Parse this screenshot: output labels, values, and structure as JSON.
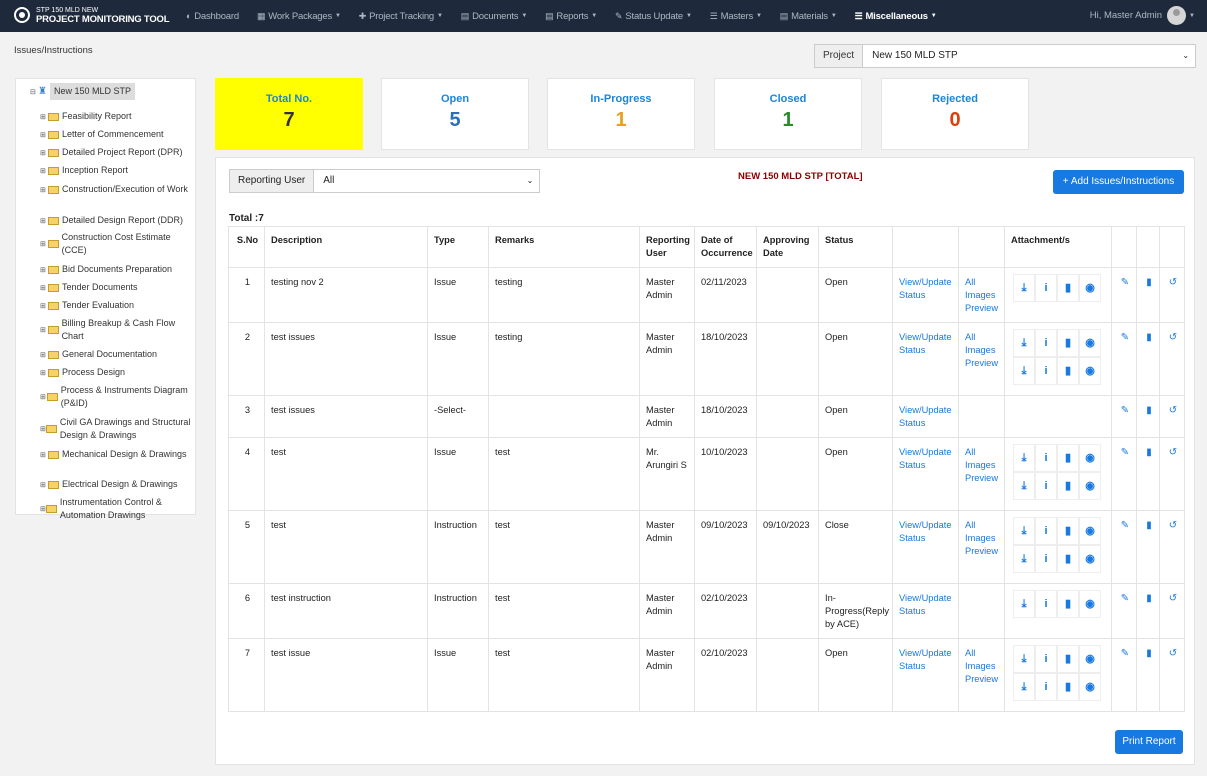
{
  "brand": {
    "subtitle": "STP 150 MLD NEW",
    "title": "PROJECT MONITORING TOOL"
  },
  "menu": [
    {
      "label": "Dashboard",
      "icon": "dashboard-icon",
      "glyph": "◐"
    },
    {
      "label": "Work Packages",
      "icon": "packages-icon",
      "glyph": "▦"
    },
    {
      "label": "Project Tracking",
      "icon": "pin-icon",
      "glyph": "✚"
    },
    {
      "label": "Documents",
      "icon": "document-icon",
      "glyph": "▤"
    },
    {
      "label": "Reports",
      "icon": "report-icon",
      "glyph": "▤"
    },
    {
      "label": "Status Update",
      "icon": "edit-icon",
      "glyph": "✎"
    },
    {
      "label": "Masters",
      "icon": "database-icon",
      "glyph": "☰"
    },
    {
      "label": "Materials",
      "icon": "file-icon",
      "glyph": "▤"
    },
    {
      "label": "Miscellaneous",
      "icon": "list-icon",
      "glyph": "☰"
    }
  ],
  "user": {
    "greeting": "Hi, Master Admin"
  },
  "breadcrumb": "Issues/Instructions",
  "project": {
    "label": "Project",
    "value": "New 150 MLD STP"
  },
  "tree": {
    "root": "New 150 MLD STP",
    "items": [
      {
        "label": "Feasibility Report"
      },
      {
        "label": "Letter of Commencement"
      },
      {
        "label": "Detailed Project Report (DPR)"
      },
      {
        "label": "Inception Report"
      },
      {
        "label": "Construction/Execution of Work"
      },
      {
        "label": "Detailed Design Report (DDR)"
      },
      {
        "label": "Construction Cost Estimate (CCE)"
      },
      {
        "label": "Bid Documents Preparation"
      },
      {
        "label": "Tender Documents"
      },
      {
        "label": "Tender Evaluation"
      },
      {
        "label": "Billing Breakup & Cash Flow Chart"
      },
      {
        "label": "General Documentation"
      },
      {
        "label": "Process Design"
      },
      {
        "label": "Process & Instruments Diagram (P&ID)"
      },
      {
        "label": "Civil GA Drawings and Structural Design & Drawings"
      },
      {
        "label": "Mechanical Design & Drawings"
      },
      {
        "label": "Electrical Design & Drawings"
      },
      {
        "label": "Instrumentation Control & Automation Drawings"
      }
    ]
  },
  "cards": [
    {
      "label": "Total No.",
      "value": "7",
      "color": "#333333"
    },
    {
      "label": "Open",
      "value": "5",
      "color": "#2a6fb8"
    },
    {
      "label": "In-Progress",
      "value": "1",
      "color": "#e8a020"
    },
    {
      "label": "Closed",
      "value": "1",
      "color": "#2a8a2a"
    },
    {
      "label": "Rejected",
      "value": "0",
      "color": "#d9420f"
    }
  ],
  "filter": {
    "label": "Reporting User",
    "value": "All"
  },
  "panel": {
    "title": "NEW 150 MLD STP [TOTAL]",
    "add_label": "+ Add Issues/Instructions",
    "total": "Total :7",
    "print_label": "Print Report"
  },
  "table": {
    "headers": [
      "S.No",
      "Description",
      "Type",
      "Remarks",
      "Reporting User",
      "Date of Occurrence",
      "Approving Date",
      "Status",
      "",
      "",
      "Attachment/s",
      "",
      "",
      ""
    ],
    "rows": [
      {
        "sno": "1",
        "desc": "testing nov 2",
        "type": "Issue",
        "remarks": "testing",
        "user": "Master Admin",
        "doo": "02/11/2023",
        "appr": "",
        "status": "Open",
        "view": "View/Update Status",
        "preview": "All Images Preview",
        "att": 1
      },
      {
        "sno": "2",
        "desc": "test issues",
        "type": "Issue",
        "remarks": "testing",
        "user": "Master Admin",
        "doo": "18/10/2023",
        "appr": "",
        "status": "Open",
        "view": "View/Update Status",
        "preview": "All Images Preview",
        "att": 2
      },
      {
        "sno": "3",
        "desc": "test issues",
        "type": "-Select-",
        "remarks": "",
        "user": "Master Admin",
        "doo": "18/10/2023",
        "appr": "",
        "status": "Open",
        "view": "View/Update Status",
        "preview": "",
        "att": 0
      },
      {
        "sno": "4",
        "desc": "test",
        "type": "Issue",
        "remarks": "test",
        "user": "Mr. Arungiri S",
        "doo": "10/10/2023",
        "appr": "",
        "status": "Open",
        "view": "View/Update Status",
        "preview": "All Images Preview",
        "att": 2
      },
      {
        "sno": "5",
        "desc": "test",
        "type": "Instruction",
        "remarks": "test",
        "user": "Master Admin",
        "doo": "09/10/2023",
        "appr": "09/10/2023",
        "status": "Close",
        "view": "View/Update Status",
        "preview": "All Images Preview",
        "att": 2
      },
      {
        "sno": "6",
        "desc": "test instruction",
        "type": "Instruction",
        "remarks": "test",
        "user": "Master Admin",
        "doo": "02/10/2023",
        "appr": "",
        "status": "In-Progress(Reply by ACE)",
        "view": "View/Update Status",
        "preview": "",
        "att": 1
      },
      {
        "sno": "7",
        "desc": "test issue",
        "type": "Issue",
        "remarks": "test",
        "user": "Master Admin",
        "doo": "02/10/2023",
        "appr": "",
        "status": "Open",
        "view": "View/Update Status",
        "preview": "All Images Preview",
        "att": 2
      }
    ]
  }
}
